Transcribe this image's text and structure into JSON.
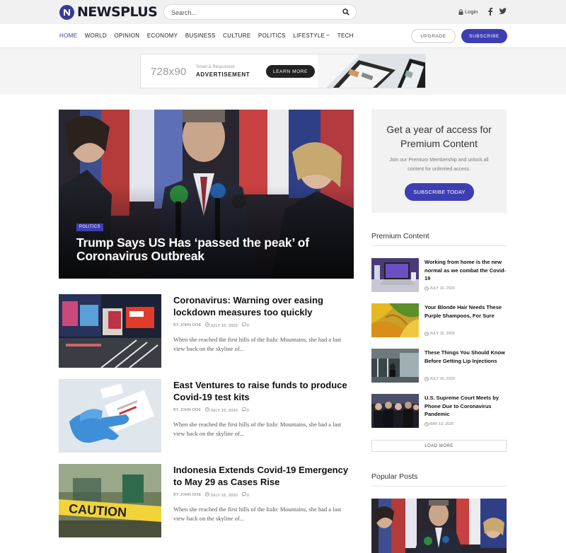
{
  "brand": {
    "name": "NEWSPLUS",
    "accent": "#3e3eb3"
  },
  "header": {
    "search_placeholder": "Search...",
    "login_label": "Login",
    "social": [
      "facebook-icon",
      "twitter-icon"
    ]
  },
  "nav": {
    "items": [
      "HOME",
      "WORLD",
      "OPINION",
      "ECONOMY",
      "BUSINESS",
      "CULTURE",
      "POLITICS",
      "LIFESTYLE",
      "TECH"
    ],
    "active": "HOME",
    "upgrade_label": "UPGRADE",
    "subscribe_label": "SUBSCRIBE"
  },
  "ad": {
    "size": "728x90",
    "sub": "Smart & Responsive",
    "title": "ADVERTISEMENT",
    "button": "LEARN MORE"
  },
  "hero": {
    "category": "POLITICS",
    "title": "Trump Says US Has ‘passed the peak’ of Coronavirus Outbreak"
  },
  "articles": [
    {
      "title": "Coronavirus: Warning over easing lockdown measures too quickly",
      "author": "BY JOHN DOE",
      "date": "JULY 16, 2020",
      "comments": "0",
      "excerpt": "When she reached the first hills of the Italic Mountains, she had a last view back on the skyline of..."
    },
    {
      "title": "East Ventures to raise funds to produce Covid-19 test kits",
      "author": "BY JOHN DOE",
      "date": "JULY 16, 2020",
      "comments": "0",
      "excerpt": "When she reached the first hills of the Italic Mountains, she had a last view back on the skyline of..."
    },
    {
      "title": "Indonesia Extends Covid-19 Emergency to May 29 as Cases Rise",
      "author": "BY JOHN DOE",
      "date": "JULY 16, 2020",
      "comments": "0",
      "excerpt": "When she reached the first hills of the Italic Mountains, she had a last view back on the skyline of..."
    }
  ],
  "promo": {
    "title": "Get a year of access for Premium Content",
    "text": "Join our Premium Membership and unlock all content for unlimited access.",
    "button": "SUBSCRIBE TODAY"
  },
  "sidebar": {
    "premium_heading": "Premium Content",
    "items": [
      {
        "title": "Working from home is the new normal as we combat the Covid-19",
        "date": "JULY 16, 2020"
      },
      {
        "title": "Your Blonde Hair Needs These Purple Shampoos, For Sure",
        "date": "JULY 16, 2020"
      },
      {
        "title": "These Things You Should Know Before Getting Lip Injections",
        "date": "JULY 16, 2020"
      },
      {
        "title": "U.S. Supreme Court Meets by Phone Due to Coronavirus Pandemic",
        "date": "MAY 13, 2020"
      }
    ],
    "load_more": "LOAD MORE",
    "popular_heading": "Popular Posts"
  }
}
